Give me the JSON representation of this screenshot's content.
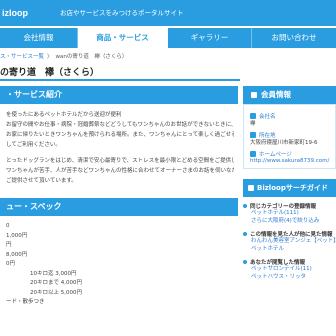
{
  "header": {
    "logo": "izloop",
    "tagline": "お店やサービスをみつけるポータルサイト"
  },
  "nav": {
    "tabs": [
      {
        "label": "会社情報"
      },
      {
        "label": "商品・サービス"
      },
      {
        "label": "ギャラリー"
      },
      {
        "label": "お問い合わせ"
      }
    ]
  },
  "breadcrumb": {
    "item1": "ス・サービス一覧",
    "sep": "〉",
    "item2": "wanの寄り道　襷（さくら）"
  },
  "page_title": "の寄り道　襷（さくら）",
  "main": {
    "section1": "・サービス紹介",
    "para1": [
      "を使ったにあるペットホテルだから送迎が便利",
      "お留守の間やお仕事・病院・冠婚葬祭などどうしてもワンちゃんのお世話ができないときに、",
      "お家に帰りたいときワンちゃんを預けられる場所。また、ワンちゃんにとって楽しく過ごせる居心地",
      "してご利用ください。"
    ],
    "para2": [
      "とったドッグランをはじめ、清潔で安心最寄りで、ストレスを最小限とどめる空間をご提供してい",
      "ワンちゃんが苦手、人が苦手などワンちゃんの性格に合わせてオーナーさまのお話を伺いながら",
      "ご提供させて頂いています。"
    ],
    "section2": "ュー・スペック",
    "prices": [
      "0",
      "1,000円",
      "円",
      "8,000円",
      "0円",
      "10キロ迄 3,000円",
      "20キロまで 4,000円",
      "20キロ以上 5,000円",
      "ード・散歩つき"
    ]
  },
  "sidebar": {
    "member_title": "会員情報",
    "company_label": "会社名",
    "company_value": "襷",
    "address_label": "所在地",
    "address_value": "大阪府寝屋川市新家町19-6",
    "homepage_label": "ホームページ",
    "homepage_value": "http://www.sakura8739.com/",
    "guide_title": "Bizloopサーチガイド",
    "guide_sections": [
      {
        "title": "同じカテゴリーの登録情報",
        "items": [
          "ペットホテル(111)",
          "さらに大阪府(4)で絞り込み"
        ]
      },
      {
        "title": "この情報を見た人が他に見た情報",
        "items": [
          "わんわん美容室アンジェ【ペット】",
          "ペットホテル"
        ]
      },
      {
        "title": "あなたが閲覧した情報",
        "items": [
          "ペットサロンテイル(11)",
          "ペットハウス・リッタ"
        ]
      }
    ]
  },
  "colors": {
    "accent": "#2a9de0",
    "link": "#2a7bd0"
  }
}
